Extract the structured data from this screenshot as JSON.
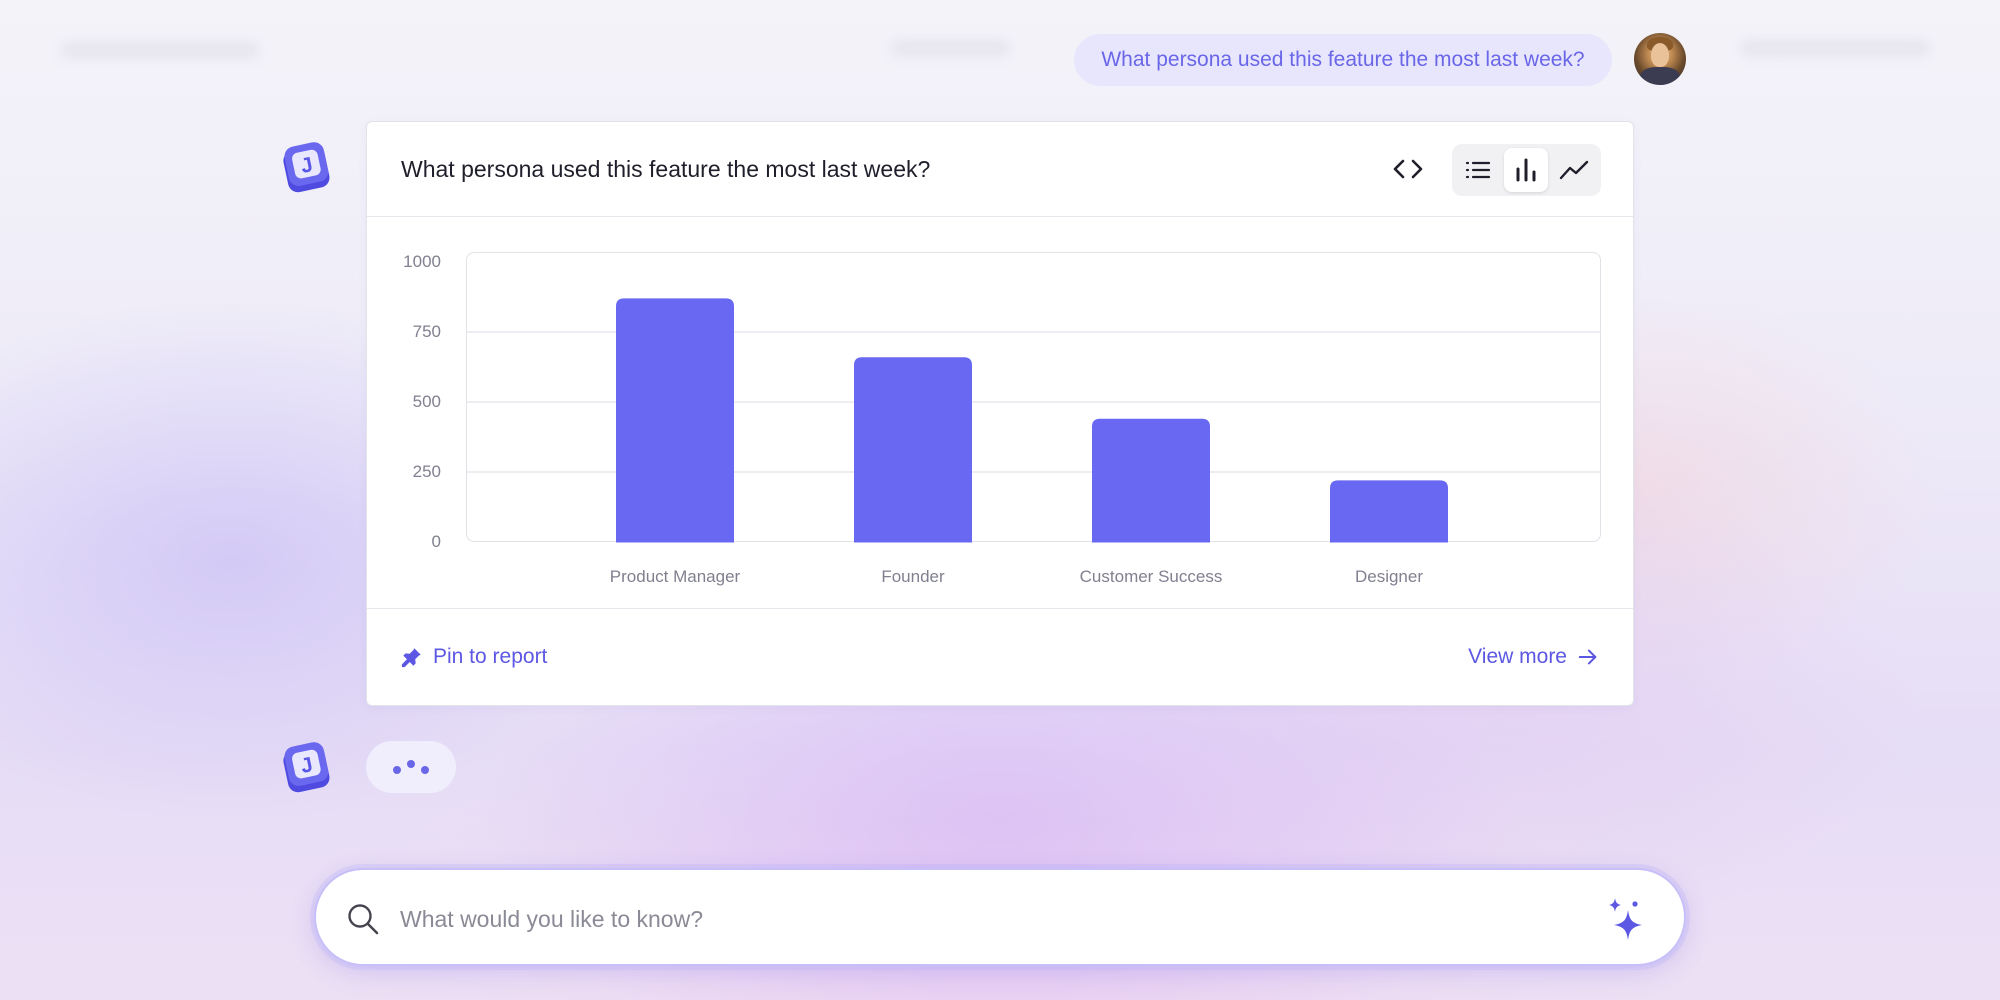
{
  "user_message": {
    "text": "What persona used this feature the most last week?"
  },
  "card": {
    "title": "What persona used this feature the most last week?",
    "pin_label": "Pin to report",
    "view_more_label": "View more",
    "active_view": "bar"
  },
  "search": {
    "placeholder": "What would you like to know?"
  },
  "colors": {
    "accent": "#6868f2",
    "link": "#5c58e3",
    "user_bubble_text": "#6a66e8"
  },
  "icons": {
    "bot": "bot-logo-icon",
    "code": "code-icon",
    "list": "list-icon",
    "bar": "bar-chart-icon",
    "line": "line-chart-icon",
    "pin": "pin-icon",
    "arrow": "arrow-right-icon",
    "search": "search-icon",
    "sparkle": "sparkle-icon"
  },
  "chart_data": {
    "type": "bar",
    "categories": [
      "Product Manager",
      "Founder",
      "Customer Success",
      "Designer"
    ],
    "values": [
      870,
      660,
      440,
      220
    ],
    "y_ticks": [
      "0",
      "250",
      "500",
      "750",
      "1000"
    ],
    "ylim": [
      0,
      1000
    ],
    "grid": true,
    "color": "#6868f2"
  }
}
